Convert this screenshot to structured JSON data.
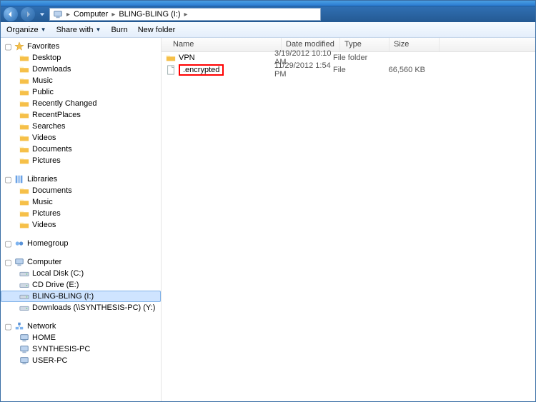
{
  "breadcrumb": {
    "root": "Computer",
    "loc": "BLING-BLING (I:)"
  },
  "toolbar": {
    "organize": "Organize",
    "share": "Share with",
    "burn": "Burn",
    "newfolder": "New folder"
  },
  "columns": {
    "name": "Name",
    "date": "Date modified",
    "type": "Type",
    "size": "Size"
  },
  "sidebar": {
    "favorites": {
      "label": "Favorites",
      "items": [
        "Desktop",
        "Downloads",
        "Music",
        "Public",
        "Recently Changed",
        "RecentPlaces",
        "Searches",
        "Videos",
        "Documents",
        "Pictures"
      ]
    },
    "libraries": {
      "label": "Libraries",
      "items": [
        "Documents",
        "Music",
        "Pictures",
        "Videos"
      ]
    },
    "homegroup": {
      "label": "Homegroup"
    },
    "computer": {
      "label": "Computer",
      "items": [
        "Local Disk (C:)",
        "CD Drive (E:)",
        "BLING-BLING (I:)",
        "Downloads (\\\\SYNTHESIS-PC) (Y:)"
      ]
    },
    "network": {
      "label": "Network",
      "items": [
        "HOME",
        "SYNTHESIS-PC",
        "USER-PC"
      ]
    }
  },
  "files": [
    {
      "name": "VPN",
      "date": "3/19/2012 10:10 AM",
      "type": "File folder",
      "size": ""
    },
    {
      "name": ".encrypted",
      "date": "11/29/2012 1:54 PM",
      "type": "File",
      "size": "66,560 KB"
    }
  ]
}
